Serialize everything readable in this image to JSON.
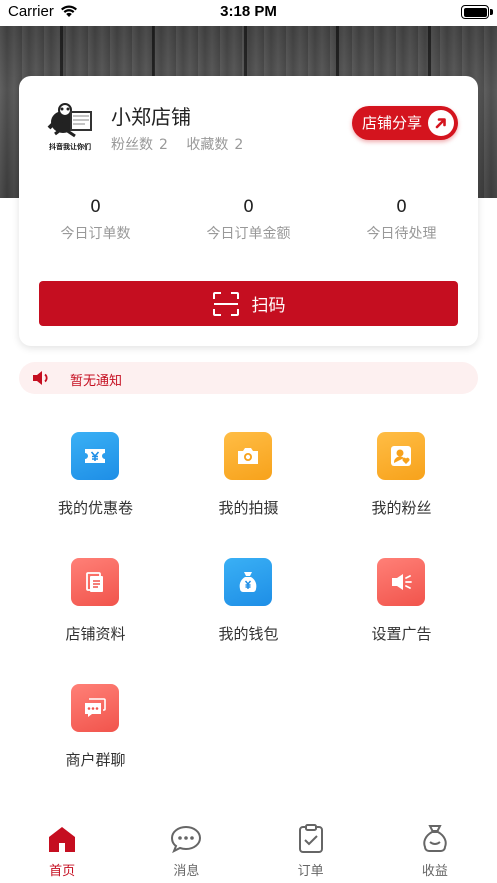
{
  "status_bar": {
    "carrier": "Carrier",
    "time": "3:18 PM"
  },
  "store": {
    "name": "小郑店铺",
    "logo_caption": "抖音我让你们",
    "fans_label": "粉丝数",
    "fans_count": "2",
    "favorites_label": "收藏数",
    "favorites_count": "2",
    "share_label": "店铺分享"
  },
  "today_stats": [
    {
      "value": "0",
      "label": "今日订单数"
    },
    {
      "value": "0",
      "label": "今日订单金额"
    },
    {
      "value": "0",
      "label": "今日待处理"
    }
  ],
  "scan_label": "扫码",
  "notice_text": "暂无通知",
  "grid": [
    {
      "label": "我的优惠卷",
      "icon": "coupon-icon"
    },
    {
      "label": "我的拍摄",
      "icon": "camera-icon"
    },
    {
      "label": "我的粉丝",
      "icon": "fans-icon"
    },
    {
      "label": "店铺资料",
      "icon": "store-info-icon"
    },
    {
      "label": "我的钱包",
      "icon": "wallet-icon"
    },
    {
      "label": "设置广告",
      "icon": "advert-icon"
    },
    {
      "label": "商户群聊",
      "icon": "group-chat-icon"
    }
  ],
  "tabs": [
    {
      "label": "首页",
      "icon": "home-icon",
      "active": true
    },
    {
      "label": "消息",
      "icon": "message-icon",
      "active": false
    },
    {
      "label": "订单",
      "icon": "order-icon",
      "active": false
    },
    {
      "label": "收益",
      "icon": "income-icon",
      "active": false
    }
  ],
  "colors": {
    "primary_red": "#c50e20",
    "share_red": "#d4141e",
    "icon_blue": "#1e8ee6",
    "icon_orange": "#f7a21b",
    "icon_red": "#f1544c",
    "notice_bg": "#fdf0f0"
  }
}
